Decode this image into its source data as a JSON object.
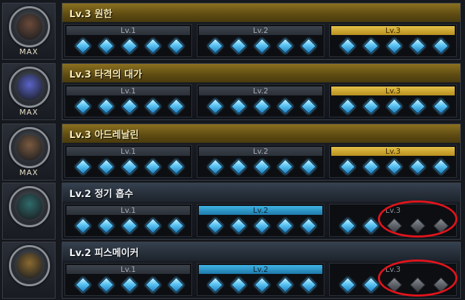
{
  "skills": [
    {
      "title": "Lv.3 원한",
      "badge": "MAX",
      "theme": "gold",
      "active_level": 3,
      "levels": [
        {
          "label": "Lv.1",
          "gems": 5,
          "lit": 5
        },
        {
          "label": "Lv.2",
          "gems": 5,
          "lit": 5
        },
        {
          "label": "Lv.3",
          "gems": 5,
          "lit": 5
        }
      ],
      "icon_color": "#6a4a3a",
      "circled": false
    },
    {
      "title": "Lv.3 타격의 대가",
      "badge": "MAX",
      "theme": "gold",
      "active_level": 3,
      "levels": [
        {
          "label": "Lv.1",
          "gems": 5,
          "lit": 5
        },
        {
          "label": "Lv.2",
          "gems": 5,
          "lit": 5
        },
        {
          "label": "Lv.3",
          "gems": 5,
          "lit": 5
        }
      ],
      "icon_color": "#5a64c8",
      "circled": false
    },
    {
      "title": "Lv.3 아드레날린",
      "badge": "MAX",
      "theme": "gold",
      "active_level": 3,
      "levels": [
        {
          "label": "Lv.1",
          "gems": 5,
          "lit": 5
        },
        {
          "label": "Lv.2",
          "gems": 5,
          "lit": 5
        },
        {
          "label": "Lv.3",
          "gems": 5,
          "lit": 5
        }
      ],
      "icon_color": "#7a5a40",
      "circled": false
    },
    {
      "title": "Lv.2 정기 흡수",
      "badge": "",
      "theme": "blue",
      "active_level": 2,
      "levels": [
        {
          "label": "Lv.1",
          "gems": 5,
          "lit": 5
        },
        {
          "label": "Lv.2",
          "gems": 5,
          "lit": 5
        },
        {
          "label": "Lv.3",
          "gems": 5,
          "lit": 2
        }
      ],
      "icon_color": "#2f6a6a",
      "circled": true
    },
    {
      "title": "Lv.2 피스메이커",
      "badge": "",
      "theme": "blue",
      "active_level": 2,
      "levels": [
        {
          "label": "Lv.1",
          "gems": 5,
          "lit": 5
        },
        {
          "label": "Lv.2",
          "gems": 5,
          "lit": 5
        },
        {
          "label": "Lv.3",
          "gems": 5,
          "lit": 2
        }
      ],
      "icon_color": "#8a6a30",
      "circled": true
    }
  ],
  "colors": {
    "gold_bar": "#8a7020",
    "blue_bar": "#36414f",
    "gem_lit": "#5cc4f2",
    "gem_off": "#5d6168",
    "highlight_circle": "#e0141b"
  }
}
